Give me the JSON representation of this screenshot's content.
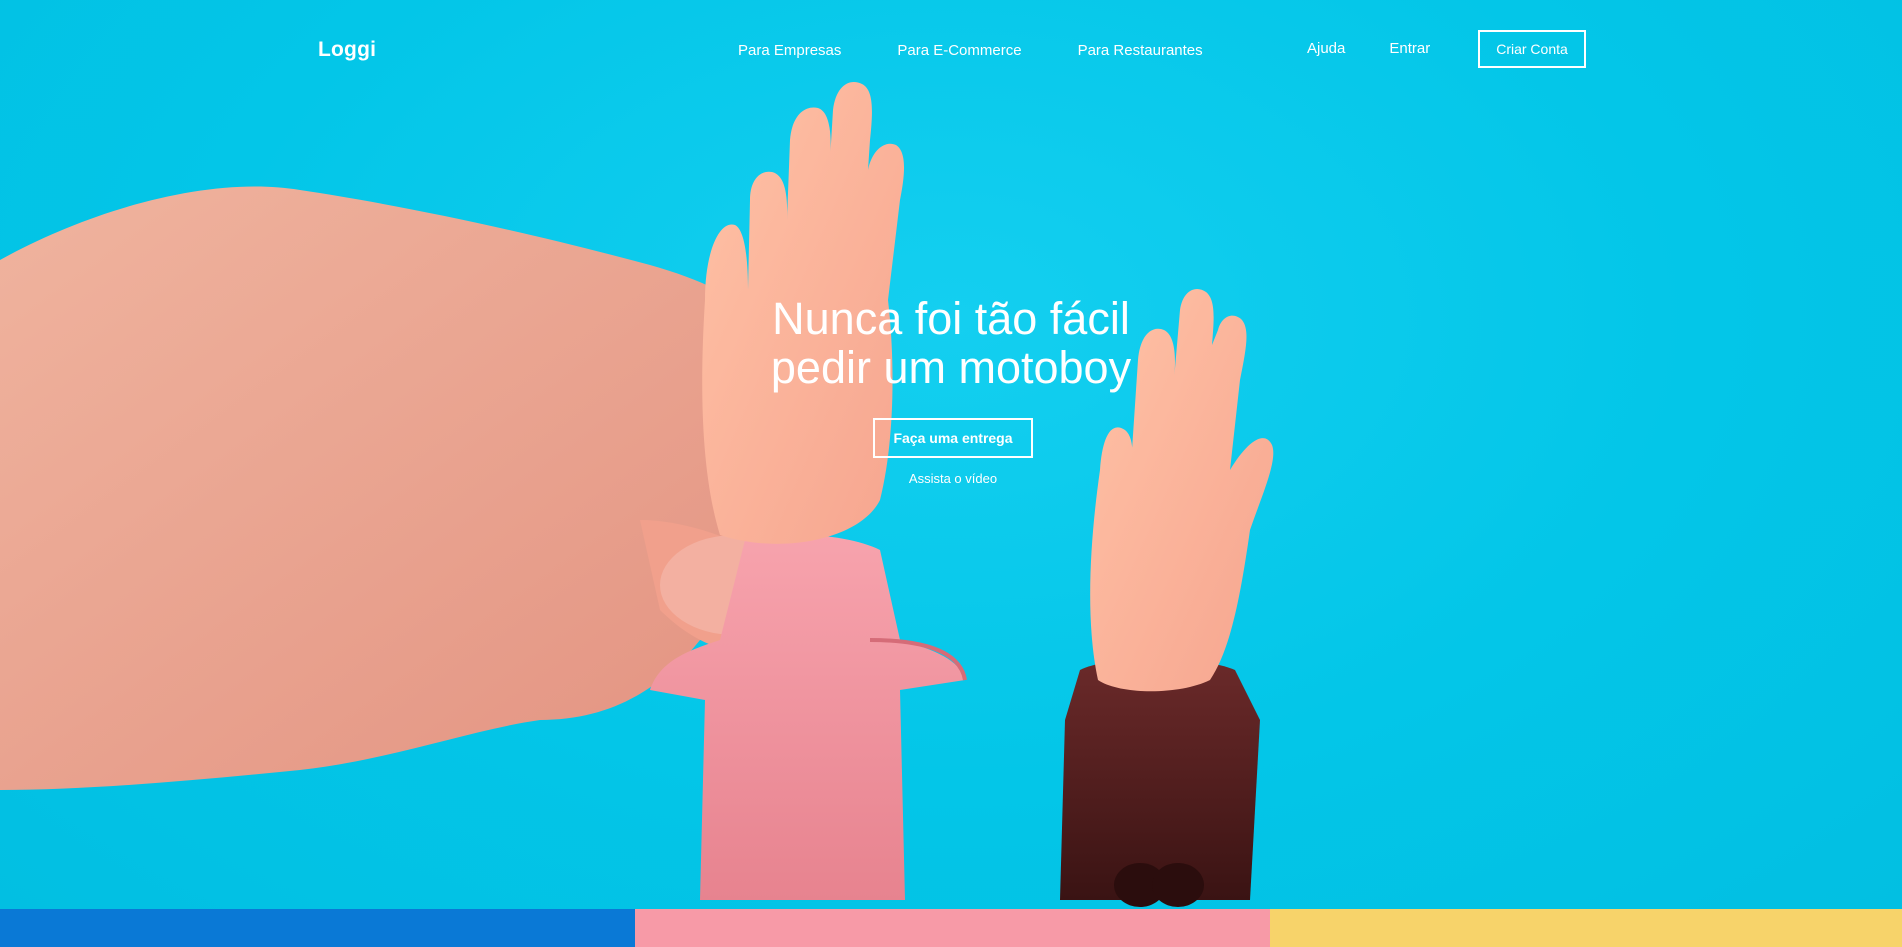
{
  "brand": {
    "logo_text": "Loggi"
  },
  "nav": {
    "center_links": [
      "Para Empresas",
      "Para E-Commerce",
      "Para Restaurantes"
    ],
    "help_label": "Ajuda",
    "login_label": "Entrar",
    "signup_label": "Criar Conta"
  },
  "hero": {
    "headline_line1": "Nunca foi tão fácil",
    "headline_line2": "pedir um motoboy",
    "primary_cta": "Faça uma entrega",
    "video_link": "Assista o vídeo",
    "background_color": "#06c9ea"
  },
  "strip_colors": [
    "#0a79d6",
    "#f79aa7",
    "#f7d36a"
  ]
}
